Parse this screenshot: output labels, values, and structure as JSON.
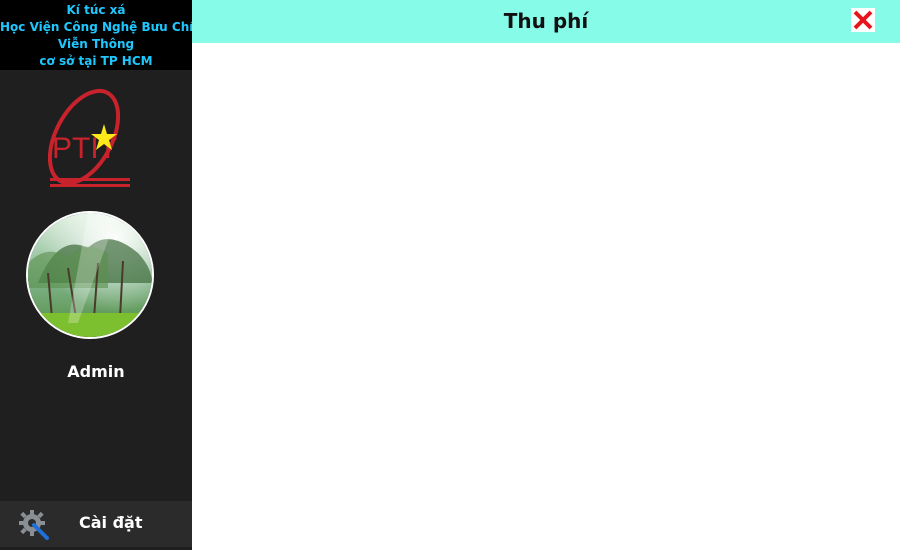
{
  "brand": {
    "line1": "Kí túc xá",
    "line2": "Học Viện Công Nghệ Bưu Chính",
    "line3": "Viễn Thông",
    "line4": "cơ sở tại TP HCM"
  },
  "logo": {
    "text": "PTIT"
  },
  "user": {
    "name": "Admin"
  },
  "settings": {
    "label": "Cài đặt",
    "icon": "wrench-gear-icon"
  },
  "header": {
    "title": "Thu phí",
    "close_icon": "close-icon"
  },
  "colors": {
    "sidebar": "#1f1f1f",
    "brand_bg": "#000000",
    "brand_text": "#1ec8ff",
    "header_bg": "#86fbe8",
    "logo_red": "#c8232c",
    "close_red": "#e8141b"
  }
}
